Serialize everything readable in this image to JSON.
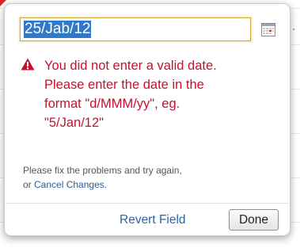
{
  "date_field": {
    "value": "25/Jab/12"
  },
  "icons": {
    "calendar": "calendar-icon",
    "warning": "warning-icon"
  },
  "error": {
    "lines": [
      "You did not enter a valid date.",
      "Please enter the date in the",
      "format \"d/MMM/yy\", eg.",
      "\"5/Jan/12\""
    ]
  },
  "help": {
    "line1": "Please fix the problems and try again,",
    "line2_prefix": "or ",
    "cancel_link": "Cancel Changes",
    "line2_suffix": "."
  },
  "actions": {
    "revert_label": "Revert Field",
    "done_label": "Done"
  },
  "colors": {
    "error_text": "#c8102e",
    "link": "#2a64a8",
    "selection": "#3178c6"
  }
}
